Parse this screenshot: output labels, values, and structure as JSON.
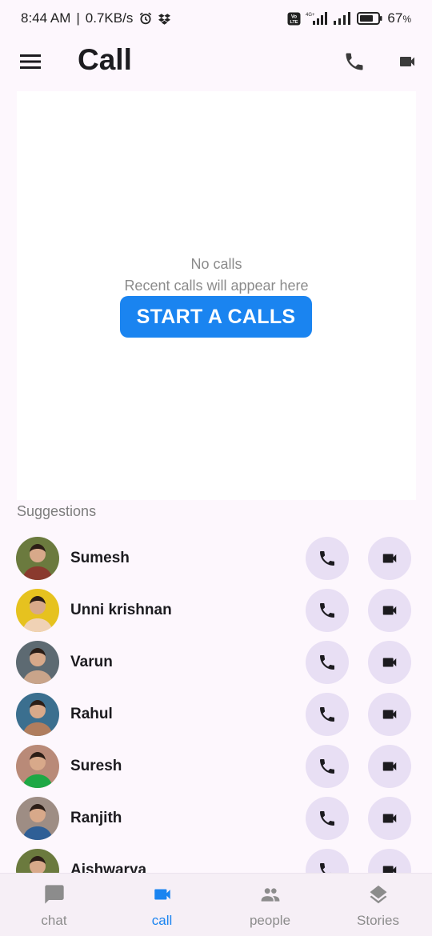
{
  "status_bar": {
    "time": "8:44 AM",
    "speed": "0.7KB/s",
    "battery": "67",
    "battery_unit": "%",
    "network_label": "4G+",
    "volte_label": "Vo LTE"
  },
  "app_bar": {
    "title": "Call"
  },
  "empty_state": {
    "title": "No calls",
    "subtitle": "Recent calls will appear here",
    "button_label": "START A CALLS"
  },
  "suggestions": {
    "label": "Suggestions",
    "contacts": [
      {
        "name": "Sumesh",
        "avatar_bg": "#6b7a3e",
        "avatar_fg": "#8a3a2e"
      },
      {
        "name": "Unni krishnan",
        "avatar_bg": "#e6c21f",
        "avatar_fg": "#f0d2b5"
      },
      {
        "name": "Varun",
        "avatar_bg": "#5d6a72",
        "avatar_fg": "#c9a48a"
      },
      {
        "name": "Rahul",
        "avatar_bg": "#3b6f8f",
        "avatar_fg": "#b07d5e"
      },
      {
        "name": "Suresh",
        "avatar_bg": "#b98a78",
        "avatar_fg": "#1ea845"
      },
      {
        "name": "Ranjith",
        "avatar_bg": "#9e8d84",
        "avatar_fg": "#2f5f96"
      },
      {
        "name": "Aishwarya",
        "avatar_bg": "#6b7a3e",
        "avatar_fg": "#8a3a2e"
      }
    ]
  },
  "bottom_nav": {
    "items": [
      {
        "label": "chat",
        "icon": "chat-icon"
      },
      {
        "label": "call",
        "icon": "videocam-icon"
      },
      {
        "label": "people",
        "icon": "people-icon"
      },
      {
        "label": "Stories",
        "icon": "layers-icon"
      }
    ],
    "active_index": 1
  },
  "colors": {
    "accent": "#1a84f0",
    "button_bg": "#e8dff4",
    "background": "#fdf7fd",
    "nav_bg": "#f6eff6"
  }
}
